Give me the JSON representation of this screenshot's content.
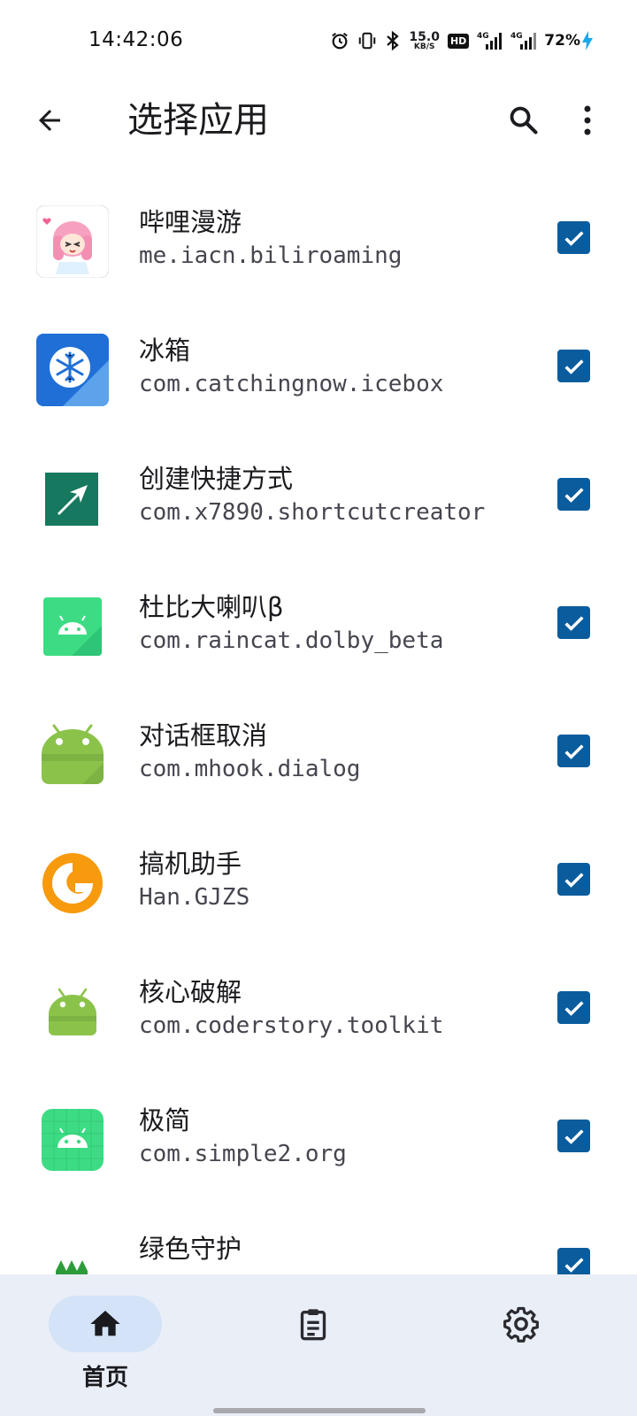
{
  "status_bar": {
    "time": "14:42:06",
    "net_speed_value": "15.0",
    "net_speed_unit": "KB/S",
    "hd_label": "HD",
    "signal_1_label": "4G",
    "signal_2_label": "4G",
    "battery_percent": "72%",
    "icons": [
      "alarm-icon",
      "vibrate-icon",
      "bluetooth-icon",
      "signal-icon",
      "charging-icon"
    ]
  },
  "app_bar": {
    "title": "选择应用",
    "icons": [
      "back-arrow-icon",
      "search-icon",
      "more-vert-icon"
    ]
  },
  "apps": [
    {
      "name": "哔哩漫游",
      "package": "me.iacn.biliroaming",
      "checked": true,
      "icon": "biliroaming-icon"
    },
    {
      "name": "冰箱",
      "package": "com.catchingnow.icebox",
      "checked": true,
      "icon": "icebox-icon"
    },
    {
      "name": "创建快捷方式",
      "package": "com.x7890.shortcutcreator",
      "checked": true,
      "icon": "shortcut-creator-icon"
    },
    {
      "name": "杜比大喇叭β",
      "package": "com.raincat.dolby_beta",
      "checked": true,
      "icon": "android-icon"
    },
    {
      "name": "对话框取消",
      "package": "com.mhook.dialog",
      "checked": true,
      "icon": "android-icon"
    },
    {
      "name": "搞机助手",
      "package": "Han.GJZS",
      "checked": true,
      "icon": "gjzs-icon"
    },
    {
      "name": "核心破解",
      "package": "com.coderstory.toolkit",
      "checked": true,
      "icon": "android-icon"
    },
    {
      "name": "极简",
      "package": "com.simple2.org",
      "checked": true,
      "icon": "android-icon"
    },
    {
      "name": "绿色守护",
      "package": "",
      "checked": true,
      "icon": "greenify-icon"
    }
  ],
  "bottom_nav": {
    "items": [
      {
        "label": "首页",
        "icon": "home-icon",
        "active": true
      },
      {
        "label": "",
        "icon": "log-icon",
        "active": false
      },
      {
        "label": "",
        "icon": "settings-icon",
        "active": false
      }
    ]
  },
  "colors": {
    "checkbox": "#0a5c9c",
    "nav_background": "#e9eef7",
    "nav_active_pill": "#d4e3f7",
    "android_green": "#3ddc84"
  }
}
